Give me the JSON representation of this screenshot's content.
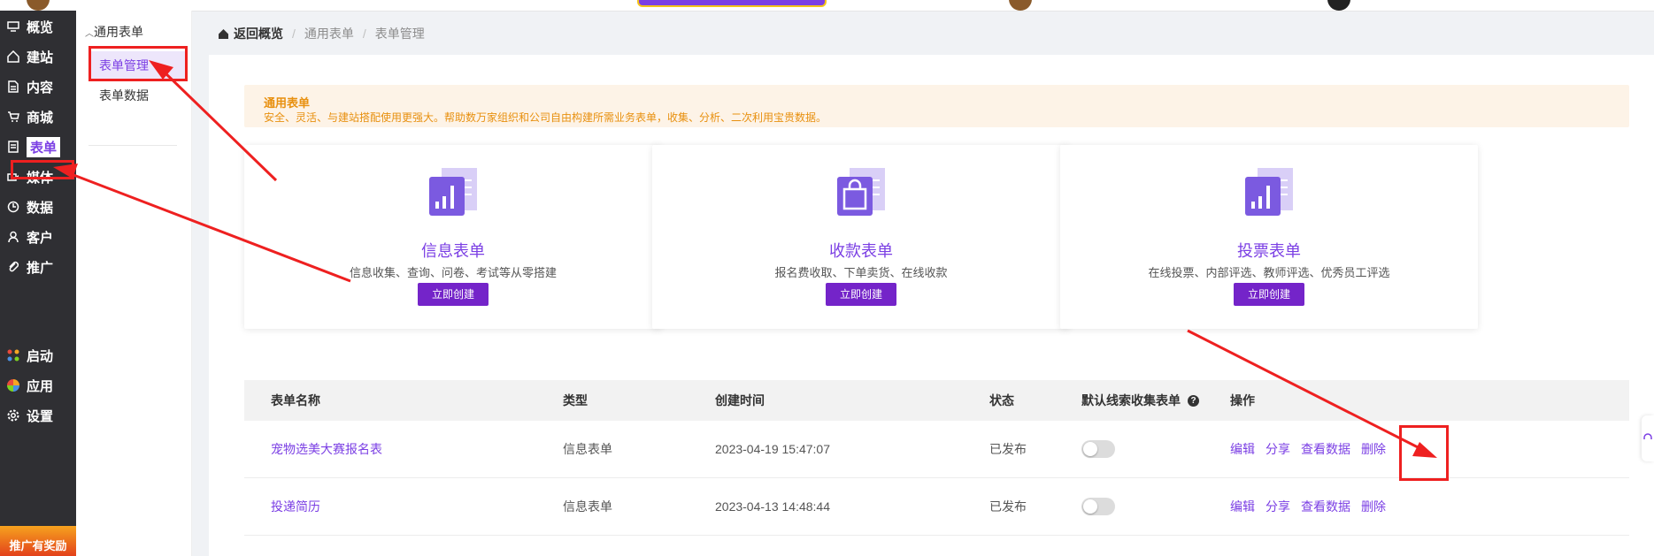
{
  "nav": {
    "items": [
      {
        "label": "概览",
        "icon": "overview-icon"
      },
      {
        "label": "建站",
        "icon": "home-icon"
      },
      {
        "label": "内容",
        "icon": "document-icon"
      },
      {
        "label": "商城",
        "icon": "cart-icon"
      },
      {
        "label": "表单",
        "icon": "form-icon"
      },
      {
        "label": "媒体",
        "icon": "video-icon"
      },
      {
        "label": "数据",
        "icon": "clock-icon"
      },
      {
        "label": "客户",
        "icon": "user-icon"
      },
      {
        "label": "推广",
        "icon": "paperclip-icon"
      }
    ],
    "bottom_items": [
      {
        "label": "启动",
        "icon": "launch-icon"
      },
      {
        "label": "应用",
        "icon": "apps-icon"
      },
      {
        "label": "设置",
        "icon": "gear-icon"
      }
    ],
    "promo": "推广有奖励"
  },
  "subnav": {
    "group": "通用表单",
    "items": [
      "表单管理",
      "表单数据"
    ]
  },
  "breadcrumb": {
    "home": "返回概览",
    "level1": "通用表单",
    "level2": "表单管理",
    "sep": "/"
  },
  "banner": {
    "title": "通用表单",
    "desc": "安全、灵活、与建站搭配使用更强大。帮助数万家组织和公司自由构建所需业务表单，收集、分析、二次利用宝贵数据。"
  },
  "cards": [
    {
      "title": "信息表单",
      "desc": "信息收集、查询、问卷、考试等从零搭建",
      "button": "立即创建",
      "icon": "chart-doc-icon"
    },
    {
      "title": "收款表单",
      "desc": "报名费收取、下单卖货、在线收款",
      "button": "立即创建",
      "icon": "shopping-bag-icon"
    },
    {
      "title": "投票表单",
      "desc": "在线投票、内部评选、教师评选、优秀员工评选",
      "button": "立即创建",
      "icon": "chart-doc-icon"
    }
  ],
  "table": {
    "headers": {
      "name": "表单名称",
      "type": "类型",
      "created": "创建时间",
      "status": "状态",
      "default_lead": "默认线索收集表单",
      "help": "?",
      "actions": "操作"
    },
    "rows": [
      {
        "name": "宠物选美大赛报名表",
        "type": "信息表单",
        "created": "2023-04-19 15:47:07",
        "status": "已发布",
        "default_lead": false
      },
      {
        "name": "投递简历",
        "type": "信息表单",
        "created": "2023-04-13 14:48:44",
        "status": "已发布",
        "default_lead": false
      }
    ],
    "actions": {
      "edit": "编辑",
      "share": "分享",
      "view": "查看数据",
      "delete": "删除"
    }
  },
  "colors": {
    "accent": "#7b3fe4",
    "button": "#7424c9",
    "nav_bg": "#2f2f33",
    "banner_bg": "#fdf3e7",
    "banner_text": "#e8900f",
    "annotation": "#ee2020"
  }
}
